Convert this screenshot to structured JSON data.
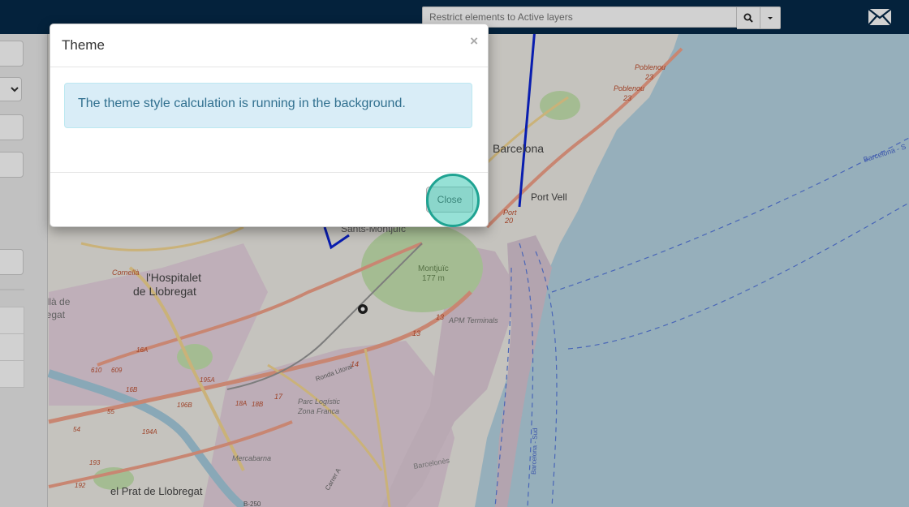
{
  "search": {
    "placeholder": "Restrict elements to Active layers"
  },
  "icons": {
    "search": "search-icon",
    "caret": "caret-down-icon",
    "mail": "envelope-icon"
  },
  "modal": {
    "title": "Theme",
    "close_symbol": "×",
    "message": "The theme style calculation is running in the background.",
    "close_label": "Close"
  },
  "map": {
    "labels": {
      "barcelona": "Barcelona",
      "port_vell": "Port Vell",
      "hospitalet_1": "l'Hospitalet",
      "hospitalet_2": "de Llobregat",
      "prat": "el Prat de Llobregat",
      "montjuic_1": "Montjuïc",
      "montjuic_2": "177 m",
      "sants_montjuic": "Sants-Montjuïc",
      "apm": "APM Terminals",
      "mercabarna": "Mercabarna",
      "parc_logistic_1": "Parc Logístic",
      "parc_logistic_2": "Zona Franca",
      "poblenou_1": "Poblenou",
      "poblenou_2": "Poblenou",
      "ronda_litoral": "Ronda Litoral",
      "barcelona_sea": "Barcelona - S",
      "barcelona_sud": "Barcelona - Sud",
      "barcelones": "Barcelonès",
      "carrer": "Carrer A",
      "cornella": "Cornellà",
      "cornella_de": "Cornellà de",
      "llobregat_short": "Llobregat",
      "b250": "B-250",
      "port": "Port",
      "num_20": "20",
      "num_23a": "23",
      "num_23b": "23",
      "num_13a": "13",
      "num_13b": "13",
      "num_14": "14",
      "num_17": "17",
      "c195a": "195A",
      "c196b": "196B",
      "c18a": "18A",
      "c18b": "18B",
      "c16a": "16A",
      "c16b": "16B",
      "c610": "610",
      "c609": "609",
      "c193": "193",
      "c192": "192",
      "c194a": "194A",
      "c55": "55",
      "c54": "54"
    },
    "colors": {
      "sea": "#b7d6e4",
      "land": "#f1eee8",
      "park": "#c9e6b2",
      "industrial": "#e7d4e0",
      "primary_road": "#f4a48c",
      "secondary_road": "#f7d994",
      "route_line": "#0b24d6"
    }
  }
}
